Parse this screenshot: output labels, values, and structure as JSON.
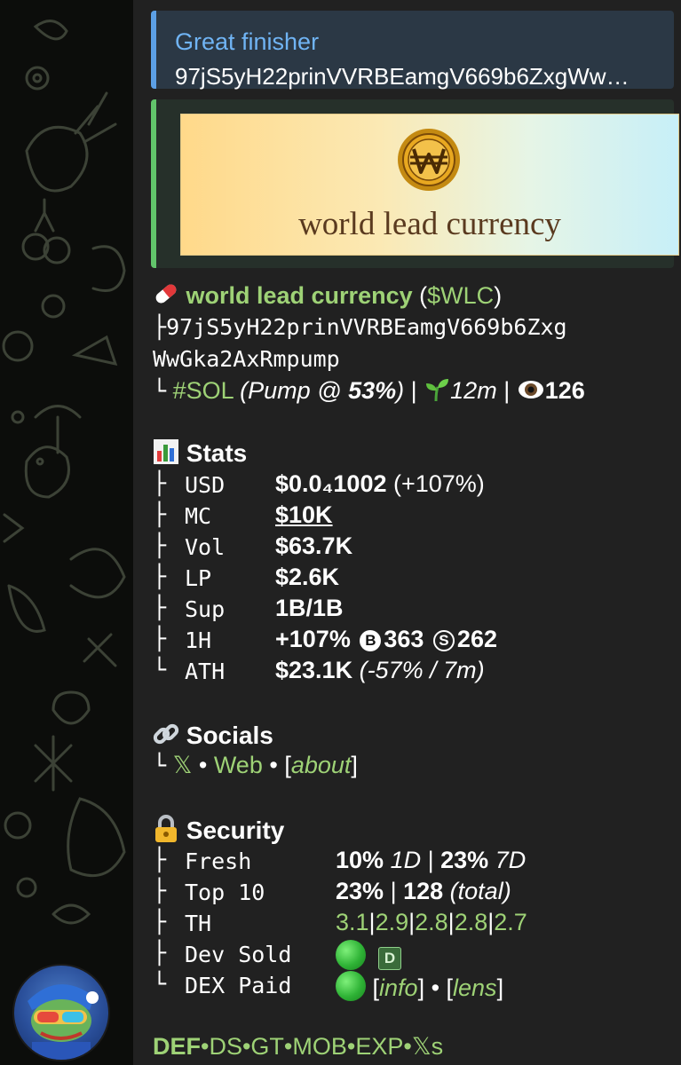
{
  "reply": {
    "title": "Great finisher",
    "text": "97jS5yH22prinVVRBEamgV669b6ZxgWw…"
  },
  "preview": {
    "banner_name": "world lead currency",
    "logo_letter": "W"
  },
  "token": {
    "name": "world lead currency",
    "ticker_open": " (",
    "ticker": "$WLC",
    "ticker_close": ")",
    "address_line1": "97jS5yH22prinVVRBEamgV669b6Zxg",
    "address_line2": "WwGka2AxRmpump",
    "chain": "#SOL",
    "pump": "(Pump @ ",
    "pump_pct": "53%",
    "pump_close": ")",
    "age": "12m",
    "views": "126"
  },
  "stats": {
    "heading": "Stats",
    "rows": [
      {
        "label": "USD",
        "value": "$0.0₄1002",
        "extra": " (+107%)"
      },
      {
        "label": "MC",
        "value": "$10K"
      },
      {
        "label": "Vol",
        "value": "$63.7K"
      },
      {
        "label": "LP",
        "value": "$2.6K"
      },
      {
        "label": "Sup",
        "value": "1B/1B"
      },
      {
        "label": "1H",
        "value": "+107%",
        "b_icon": "B",
        "b_count": "363",
        "s_icon": "S",
        "s_count": "262"
      },
      {
        "label": "ATH",
        "value": "$23.1K",
        "extra": " (-57% / 7m)"
      }
    ]
  },
  "socials": {
    "heading": "Socials",
    "x": "𝕏",
    "sep": " • ",
    "web": "Web",
    "about_open": "[",
    "about": "about",
    "about_close": "]"
  },
  "security": {
    "heading": "Security",
    "fresh_label": "Fresh",
    "fresh_a": "10%",
    "fresh_a_unit": "1D",
    "fresh_b": "23%",
    "fresh_b_unit": "7D",
    "top10_label": "Top 10",
    "top10_pct": "23%",
    "top10_count": "128",
    "top10_unit": "(total)",
    "th_label": "TH",
    "th_values": [
      "3.1",
      "2.9",
      "2.8",
      "2.8",
      "2.7"
    ],
    "devsold_label": "Dev Sold",
    "devsold_badge": "D",
    "dexpaid_label": "DEX Paid",
    "info": "info",
    "lens": "lens"
  },
  "footer": [
    "DEF",
    "DS",
    "GT",
    "MOB",
    "EXP",
    "𝕏s"
  ],
  "colors": {
    "bubble_bg": "#212121",
    "link_green": "#9ed276",
    "reply_accent": "#5ca0e6",
    "preview_accent": "#62c56b",
    "reply_title": "#70b4f4"
  }
}
